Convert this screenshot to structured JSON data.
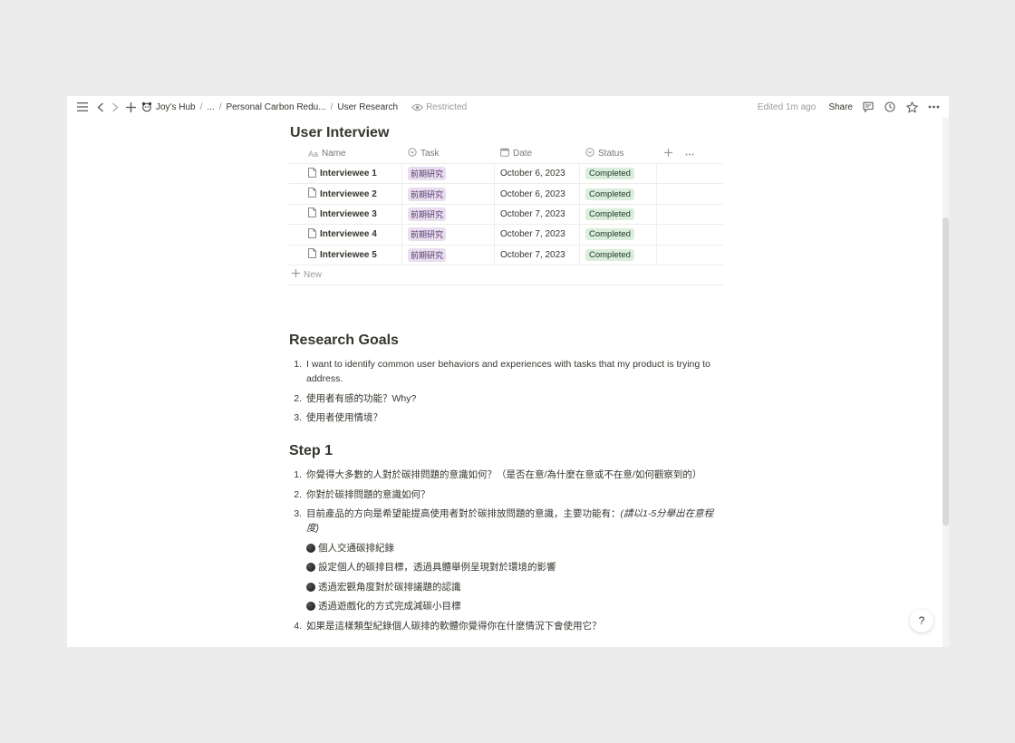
{
  "breadcrumb": {
    "workspace": "Joy's Hub",
    "ellipsis": "...",
    "parent": "Personal Carbon Redu...",
    "current": "User Research",
    "restricted": "Restricted"
  },
  "topbar": {
    "edited": "Edited 1m ago",
    "share": "Share"
  },
  "database": {
    "title": "User Interview",
    "columns": {
      "name": "Name",
      "name_prefix": "Aa",
      "task": "Task",
      "date": "Date",
      "status": "Status"
    },
    "rows": [
      {
        "name": "Interviewee 1",
        "task": "前期研究",
        "date": "October 6, 2023",
        "status": "Completed"
      },
      {
        "name": "Interviewee 2",
        "task": "前期研究",
        "date": "October 6, 2023",
        "status": "Completed"
      },
      {
        "name": "Interviewee 3",
        "task": "前期研究",
        "date": "October 7, 2023",
        "status": "Completed"
      },
      {
        "name": "Interviewee 4",
        "task": "前期研究",
        "date": "October 7, 2023",
        "status": "Completed"
      },
      {
        "name": "Interviewee 5",
        "task": "前期研究",
        "date": "October 7, 2023",
        "status": "Completed"
      }
    ],
    "new_label": "New"
  },
  "goals": {
    "heading": "Research Goals",
    "items": [
      {
        "num": "1.",
        "text": "I want to identify common user behaviors and experiences with tasks that my product is trying to address."
      },
      {
        "num": "2.",
        "text": "使用者有感的功能？Why?"
      },
      {
        "num": "3.",
        "text": "使用者使用情境？"
      }
    ]
  },
  "step1": {
    "heading": "Step 1",
    "items": [
      {
        "num": "1.",
        "text": "你覺得大多數的人對於碳排問題的意識如何？（是否在意/為什麼在意或不在意/如何觀察到的）"
      },
      {
        "num": "2.",
        "text": "你對於碳排問題的意識如何？"
      },
      {
        "num": "3.",
        "text": "目前產品的方向是希望能提高使用者對於碳排放問題的意識，主要功能有：",
        "italic": "(請以1-5分舉出在意程度)"
      },
      {
        "num": "4.",
        "text": "如果是這樣類型紀錄個人碳排的軟體你覺得你在什麼情況下會使用它？"
      }
    ],
    "features": [
      "個人交通碳排紀錄",
      "設定個人的碳排目標，透過具體舉例呈現對於環境的影響",
      "透過宏觀角度對於碳排議題的認識",
      "透過遊戲化的方式完成減碳小目標"
    ]
  },
  "help": "?"
}
